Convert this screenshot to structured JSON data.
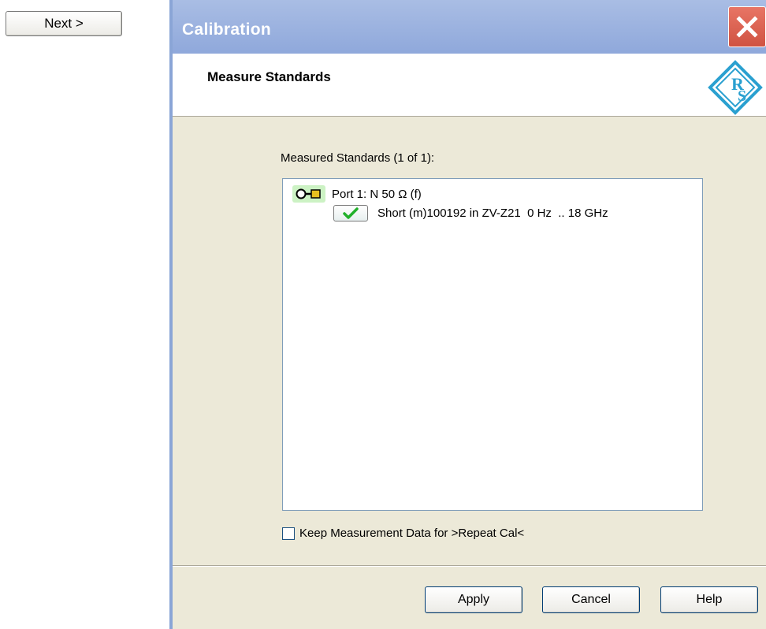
{
  "next_button": {
    "label": "Next >"
  },
  "dialog": {
    "title": "Calibration",
    "header_title": "Measure Standards",
    "list_label": "Measured Standards (1 of 1):",
    "port": {
      "label": "Port 1: N 50 Ω (f)",
      "icon": "connector-icon"
    },
    "standard": {
      "label": "Short (m)100192 in ZV-Z21  0 Hz  .. 18 GHz",
      "icon": "checkmark-icon"
    },
    "keep_checkbox": {
      "label": "Keep Measurement Data for >Repeat Cal<",
      "checked": false
    },
    "buttons": {
      "apply": "Apply",
      "cancel": "Cancel",
      "help": "Help"
    }
  },
  "colors": {
    "titlebar": "#a9bde4",
    "close_button": "#d9604f",
    "dialog_background": "#ece9d8",
    "logo": "#2aa0d0",
    "port_highlight": "#ccf2c4",
    "checkmark": "#21b02a"
  }
}
